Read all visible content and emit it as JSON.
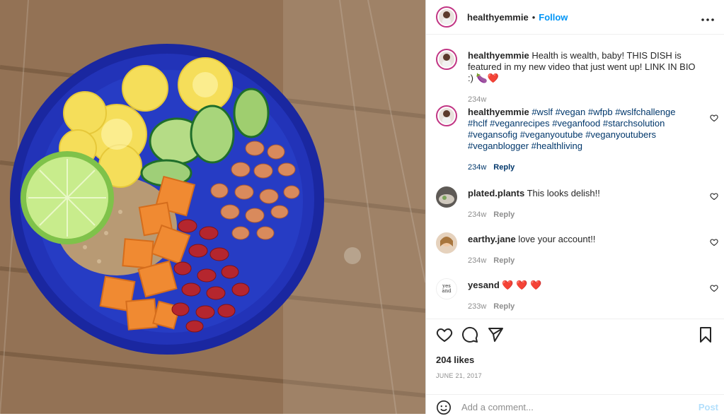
{
  "post": {
    "username": "healthyemmie",
    "follow_label": "Follow",
    "more_label": "•••",
    "separator": "•"
  },
  "comments": [
    {
      "username": "healthyemmie",
      "text": " Health is wealth, baby! THIS DISH is featured in my new video that just went up! LINK IN BIO :)",
      "emoji": "🍆❤️",
      "time": "234w",
      "reply": ""
    },
    {
      "username": "healthyemmie",
      "hashtags": [
        "#wslf",
        "#vegan",
        "#wfpb",
        "#wslfchallenge",
        "#hclf",
        "#veganrecipes",
        "#veganfood",
        "#starchsolution",
        "#vegansofig",
        "#veganyoutube",
        "#veganyoutubers",
        "#veganblogger",
        "#healthliving"
      ],
      "time": "234w",
      "reply": "Reply"
    },
    {
      "username": "plated.plants",
      "text": " This looks delish!!",
      "time": "234w",
      "reply": "Reply"
    },
    {
      "username": "earthy.jane",
      "text": " love your account!!",
      "time": "234w",
      "reply": "Reply"
    },
    {
      "username": "yesand",
      "text": " ❤️ ❤️ ❤️",
      "time": "233w",
      "reply": "Reply",
      "avatar_text": "yes and"
    }
  ],
  "engagement": {
    "likes": "204 likes",
    "date": "JUNE 21, 2017"
  },
  "composer": {
    "placeholder": "Add a comment...",
    "post_label": "Post"
  },
  "icons": [
    "more-icon",
    "heart-icon",
    "comment-icon",
    "share-icon",
    "bookmark-icon",
    "emoji-icon"
  ],
  "colors": {
    "link": "#0095f6",
    "hashtag": "#00376b",
    "muted": "#8e8e8e",
    "bowl": "#1e2fb0"
  }
}
